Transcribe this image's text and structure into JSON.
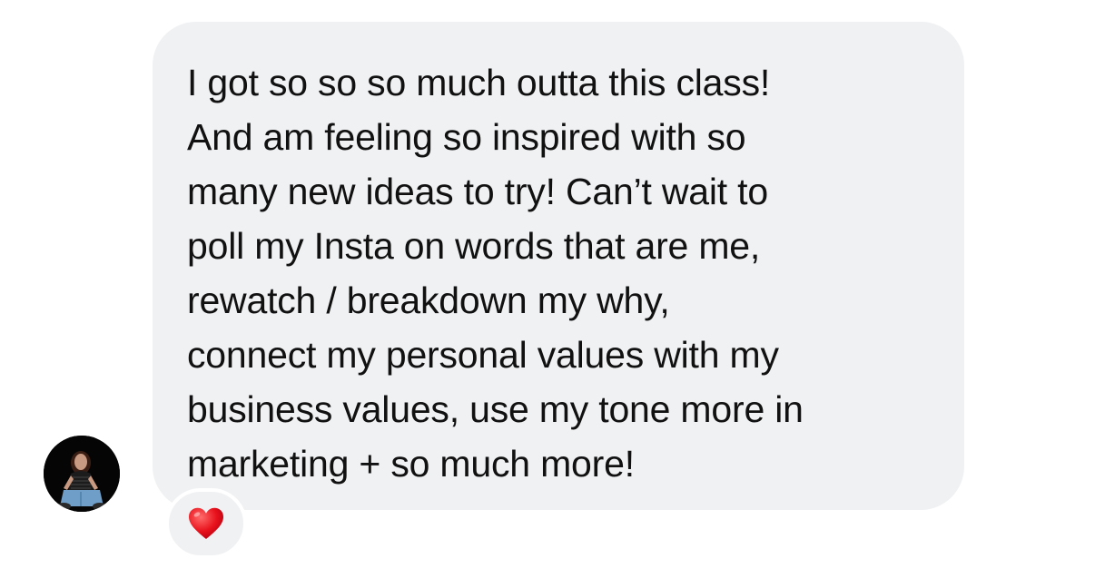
{
  "message": {
    "lines": [
      "I got so so so much outta this class!",
      "And am feeling so inspired with so",
      "many new ideas to try! Can’t wait to",
      "poll my Insta on words that are me,",
      "rewatch / breakdown my why,",
      "connect my personal values with my",
      "business values, use my tone more in",
      "marketing + so much more!"
    ]
  },
  "sender": {
    "avatar_icon": "user-photo-icon"
  },
  "reaction": {
    "icon": "red-heart-icon",
    "color": "#e8121c"
  },
  "colors": {
    "bubble_background": "#f0f1f3",
    "text": "#111111"
  }
}
